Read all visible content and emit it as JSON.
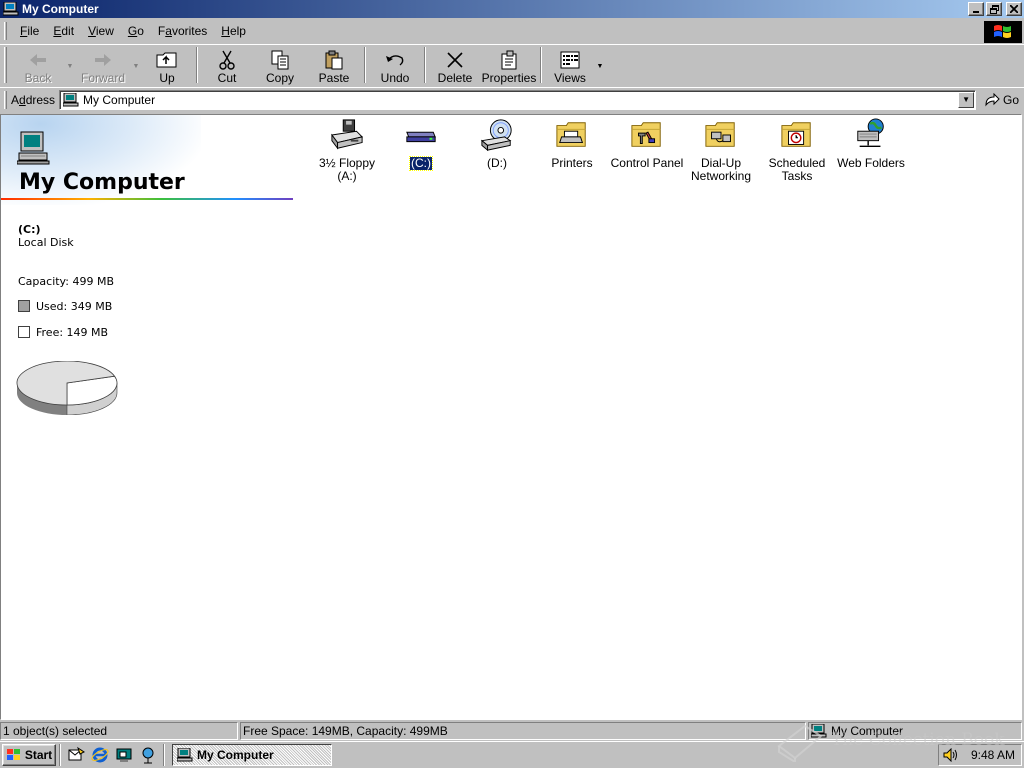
{
  "window": {
    "title": "My Computer"
  },
  "menu": [
    {
      "key": "F",
      "rest": "ile"
    },
    {
      "key": "E",
      "rest": "dit"
    },
    {
      "key": "V",
      "rest": "iew"
    },
    {
      "key": "G",
      "rest": "o"
    },
    {
      "pre": "F",
      "key": "a",
      "rest": "vorites"
    },
    {
      "key": "H",
      "rest": "elp"
    }
  ],
  "toolbar": {
    "back": "Back",
    "forward": "Forward",
    "up": "Up",
    "cut": "Cut",
    "copy": "Copy",
    "paste": "Paste",
    "undo": "Undo",
    "delete": "Delete",
    "properties": "Properties",
    "views": "Views"
  },
  "address": {
    "label": "Address",
    "label_key": "d",
    "value": "My Computer",
    "go": "Go"
  },
  "left_panel": {
    "title": "My Computer",
    "drive_name": "(C:)",
    "drive_type": "Local Disk",
    "capacity": "Capacity: 499 MB",
    "used": "Used: 349 MB",
    "free": "Free: 149 MB",
    "used_fraction": 0.7
  },
  "icons": [
    {
      "label": "3½ Floppy (A:)",
      "icon": "floppy-drive-icon"
    },
    {
      "label": "(C:)",
      "icon": "hard-disk-icon",
      "selected": true
    },
    {
      "label": "(D:)",
      "icon": "cd-drive-icon"
    },
    {
      "label": "Printers",
      "icon": "printers-folder-icon"
    },
    {
      "label": "Control Panel",
      "icon": "control-panel-folder-icon"
    },
    {
      "label": "Dial-Up Networking",
      "icon": "dialup-folder-icon"
    },
    {
      "label": "Scheduled Tasks",
      "icon": "scheduled-tasks-folder-icon"
    },
    {
      "label": "Web Folders",
      "icon": "web-folders-icon"
    }
  ],
  "status": {
    "selection": "1 object(s) selected",
    "space": "Free Space: 149MB,  Capacity: 499MB",
    "location": "My Computer"
  },
  "taskbar": {
    "start": "Start",
    "task": "My Computer",
    "clock": "9:48 AM"
  },
  "watermark": "The Collection Book"
}
